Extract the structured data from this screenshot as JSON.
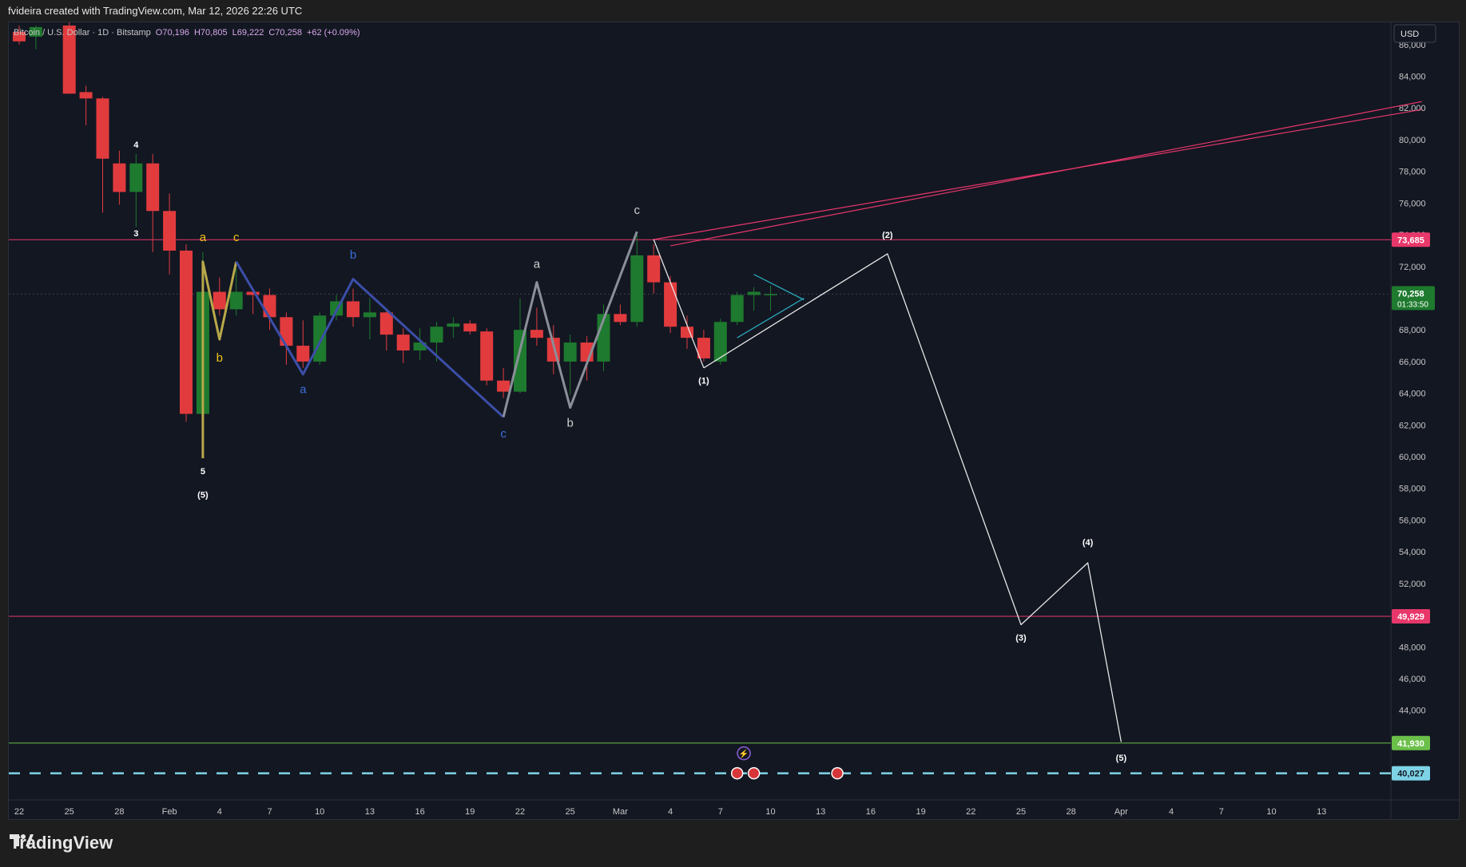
{
  "header": {
    "credit": "fvideira created with TradingView.com, Mar 12, 2026 22:26 UTC"
  },
  "legend": {
    "title": "Bitcoin / U.S. Dollar · 1D · Bitstamp",
    "open": "O70,196",
    "high": "H70,805",
    "low": "L69,222",
    "close": "C70,258",
    "change": "+62 (+0.09%)"
  },
  "currency": "USD",
  "footer": {
    "brand": "TradingView"
  },
  "colors": {
    "up": "#1e7a2e",
    "down": "#e23b3e",
    "bg": "#131722",
    "resistance": "#e8376a",
    "support": "#6bc04a",
    "dashed": "#7ed4e6"
  },
  "chart_data": {
    "type": "candlestick",
    "ylim": [
      39200,
      87400
    ],
    "x_labels": [
      "22",
      "25",
      "28",
      "Feb",
      "4",
      "7",
      "10",
      "13",
      "16",
      "19",
      "22",
      "25",
      "Mar",
      "4",
      "7",
      "10",
      "13",
      "16",
      "19",
      "22",
      "25",
      "28",
      "Apr",
      "4",
      "7",
      "10",
      "13"
    ],
    "y_ticks": [
      44000,
      46000,
      48000,
      50000,
      52000,
      54000,
      56000,
      58000,
      60000,
      62000,
      64000,
      66000,
      68000,
      70000,
      72000,
      74000,
      76000,
      78000,
      80000,
      82000,
      84000,
      86000
    ],
    "candles": [
      {
        "day": 0,
        "o": 86800,
        "h": 87200,
        "l": 86000,
        "c": 86200
      },
      {
        "day": 1,
        "o": 86500,
        "h": 87200,
        "l": 85700,
        "c": 87100
      },
      {
        "day": 3,
        "o": 87200,
        "h": 87400,
        "l": 82900,
        "c": 82900
      },
      {
        "day": 4,
        "o": 83000,
        "h": 83400,
        "l": 80900,
        "c": 82600
      },
      {
        "day": 5,
        "o": 82600,
        "h": 82700,
        "l": 75400,
        "c": 78800
      },
      {
        "day": 6,
        "o": 78500,
        "h": 79300,
        "l": 75900,
        "c": 76700
      },
      {
        "day": 7,
        "o": 76700,
        "h": 79100,
        "l": 74500,
        "c": 78500
      },
      {
        "day": 8,
        "o": 78500,
        "h": 79100,
        "l": 72900,
        "c": 75500
      },
      {
        "day": 9,
        "o": 75500,
        "h": 76600,
        "l": 71500,
        "c": 73000
      },
      {
        "day": 10,
        "o": 73000,
        "h": 73400,
        "l": 62200,
        "c": 62700
      },
      {
        "day": 11,
        "o": 62700,
        "h": 72900,
        "l": 59900,
        "c": 70400
      },
      {
        "day": 12,
        "o": 70400,
        "h": 71300,
        "l": 68900,
        "c": 69300
      },
      {
        "day": 13,
        "o": 69300,
        "h": 71900,
        "l": 68900,
        "c": 70400
      },
      {
        "day": 14,
        "o": 70400,
        "h": 70600,
        "l": 69000,
        "c": 70200
      },
      {
        "day": 15,
        "o": 70200,
        "h": 70600,
        "l": 68000,
        "c": 68800
      },
      {
        "day": 16,
        "o": 68800,
        "h": 69100,
        "l": 65800,
        "c": 67000
      },
      {
        "day": 17,
        "o": 67000,
        "h": 68600,
        "l": 65600,
        "c": 66000
      },
      {
        "day": 18,
        "o": 66000,
        "h": 69100,
        "l": 65800,
        "c": 68900
      },
      {
        "day": 19,
        "o": 68900,
        "h": 70200,
        "l": 68600,
        "c": 69800
      },
      {
        "day": 20,
        "o": 69800,
        "h": 70600,
        "l": 68200,
        "c": 68800
      },
      {
        "day": 21,
        "o": 68800,
        "h": 70000,
        "l": 67400,
        "c": 69100
      },
      {
        "day": 22,
        "o": 69100,
        "h": 69300,
        "l": 66700,
        "c": 67700
      },
      {
        "day": 23,
        "o": 67700,
        "h": 68100,
        "l": 65900,
        "c": 66700
      },
      {
        "day": 24,
        "o": 66700,
        "h": 68100,
        "l": 66100,
        "c": 67200
      },
      {
        "day": 25,
        "o": 67200,
        "h": 68500,
        "l": 66000,
        "c": 68200
      },
      {
        "day": 26,
        "o": 68200,
        "h": 68800,
        "l": 67500,
        "c": 68400
      },
      {
        "day": 27,
        "o": 68400,
        "h": 68600,
        "l": 67700,
        "c": 67900
      },
      {
        "day": 28,
        "o": 67900,
        "h": 68100,
        "l": 64500,
        "c": 64800
      },
      {
        "day": 29,
        "o": 64800,
        "h": 65600,
        "l": 63700,
        "c": 64100
      },
      {
        "day": 30,
        "o": 64100,
        "h": 70000,
        "l": 64000,
        "c": 68000
      },
      {
        "day": 31,
        "o": 68000,
        "h": 69400,
        "l": 67000,
        "c": 67500
      },
      {
        "day": 32,
        "o": 67500,
        "h": 68300,
        "l": 65200,
        "c": 66000
      },
      {
        "day": 33,
        "o": 66000,
        "h": 67700,
        "l": 63900,
        "c": 67200
      },
      {
        "day": 34,
        "o": 67200,
        "h": 67600,
        "l": 64800,
        "c": 66000
      },
      {
        "day": 35,
        "o": 66000,
        "h": 69600,
        "l": 65400,
        "c": 69000
      },
      {
        "day": 36,
        "o": 69000,
        "h": 69600,
        "l": 68300,
        "c": 68500
      },
      {
        "day": 37,
        "o": 68500,
        "h": 74000,
        "l": 68200,
        "c": 72700
      },
      {
        "day": 38,
        "o": 72700,
        "h": 73400,
        "l": 70300,
        "c": 71000
      },
      {
        "day": 39,
        "o": 71000,
        "h": 71400,
        "l": 67800,
        "c": 68200
      },
      {
        "day": 40,
        "o": 68200,
        "h": 68900,
        "l": 66800,
        "c": 67500
      },
      {
        "day": 41,
        "o": 67500,
        "h": 68000,
        "l": 66000,
        "c": 66200
      },
      {
        "day": 42,
        "o": 66000,
        "h": 68700,
        "l": 65800,
        "c": 68500
      },
      {
        "day": 43,
        "o": 68500,
        "h": 70400,
        "l": 68300,
        "c": 70200
      },
      {
        "day": 44,
        "o": 70200,
        "h": 70700,
        "l": 69200,
        "c": 70400
      },
      {
        "day": 45,
        "o": 70200,
        "h": 70800,
        "l": 69200,
        "c": 70258
      }
    ],
    "lines": [
      {
        "name": "resistance",
        "value": 73685,
        "label": "73,685",
        "color": "#e8376a"
      },
      {
        "name": "support",
        "value": 49929,
        "label": "49,929",
        "color": "#e8376a"
      },
      {
        "name": "target",
        "value": 41930,
        "label": "41,930",
        "color": "#6bc04a"
      },
      {
        "name": "dashed-level",
        "value": 40027,
        "label": "40,027",
        "color": "#7ed4e6"
      }
    ],
    "current_price": {
      "label": "70,258",
      "countdown": "01:33:50"
    },
    "fan_lines": [
      {
        "from": [
          39,
          73300
        ],
        "to": [
          84,
          82400
        ]
      },
      {
        "from": [
          38,
          73700
        ],
        "to": [
          84,
          81900
        ]
      }
    ],
    "paths": [
      {
        "name": "wave-yellow",
        "color": "#b8a94a",
        "points": [
          [
            11,
            59900
          ],
          [
            11,
            72300
          ],
          [
            12,
            67400
          ],
          [
            13,
            72300
          ]
        ]
      },
      {
        "name": "wave-blue",
        "color": "#3c4ea8",
        "points": [
          [
            13,
            72300
          ],
          [
            17,
            65200
          ],
          [
            20,
            71200
          ],
          [
            29,
            62500
          ]
        ]
      },
      {
        "name": "wave-grey",
        "color": "#8a8f99",
        "points": [
          [
            29,
            62500
          ],
          [
            31,
            71000
          ],
          [
            33,
            63100
          ],
          [
            37,
            74200
          ]
        ]
      },
      {
        "name": "wave-white-1",
        "color": "#e6e6e6",
        "points": [
          [
            38,
            73700
          ],
          [
            41,
            65600
          ]
        ]
      },
      {
        "name": "projection-white",
        "color": "#e6e6e6",
        "points": [
          [
            41,
            65600
          ],
          [
            52,
            72800
          ],
          [
            60,
            49400
          ],
          [
            64,
            53300
          ],
          [
            66,
            42000
          ]
        ]
      },
      {
        "name": "triangle-cyan-upper",
        "color": "#2aa8b8",
        "points": [
          [
            44,
            71500
          ],
          [
            47,
            69900
          ]
        ]
      },
      {
        "name": "triangle-cyan-lower",
        "color": "#2aa8b8",
        "points": [
          [
            43,
            67500
          ],
          [
            47,
            70000
          ]
        ]
      }
    ],
    "annotations": [
      {
        "text": "4",
        "day": 7,
        "y": 79500,
        "color": "#ffffff"
      },
      {
        "text": "3",
        "day": 7,
        "y": 73900,
        "color": "#ffffff"
      },
      {
        "text": "a",
        "day": 11,
        "y": 73600,
        "color": "#f0c419"
      },
      {
        "text": "c",
        "day": 13,
        "y": 73600,
        "color": "#f0c419"
      },
      {
        "text": "b",
        "day": 12,
        "y": 66000,
        "color": "#f0c419"
      },
      {
        "text": "5",
        "day": 11,
        "y": 58900,
        "color": "#ffffff"
      },
      {
        "text": "(5)",
        "day": 11,
        "y": 57400,
        "color": "#ffffff"
      },
      {
        "text": "b",
        "day": 20,
        "y": 72500,
        "color": "#3a6fd8"
      },
      {
        "text": "a",
        "day": 17,
        "y": 64000,
        "color": "#3a6fd8"
      },
      {
        "text": "c",
        "day": 29,
        "y": 61200,
        "color": "#3a6fd8"
      },
      {
        "text": "a",
        "day": 31,
        "y": 71900,
        "color": "#cfcfcf"
      },
      {
        "text": "b",
        "day": 33,
        "y": 61900,
        "color": "#cfcfcf"
      },
      {
        "text": "c",
        "day": 37,
        "y": 75300,
        "color": "#cfcfcf"
      },
      {
        "text": "(1)",
        "day": 41,
        "y": 64600,
        "color": "#ffffff"
      },
      {
        "text": "(2)",
        "day": 52,
        "y": 73800,
        "color": "#ffffff"
      },
      {
        "text": "(3)",
        "day": 60,
        "y": 48400,
        "color": "#ffffff"
      },
      {
        "text": "(4)",
        "day": 64,
        "y": 54400,
        "color": "#ffffff"
      },
      {
        "text": "(5)",
        "day": 66,
        "y": 40800,
        "color": "#ffffff"
      }
    ]
  }
}
